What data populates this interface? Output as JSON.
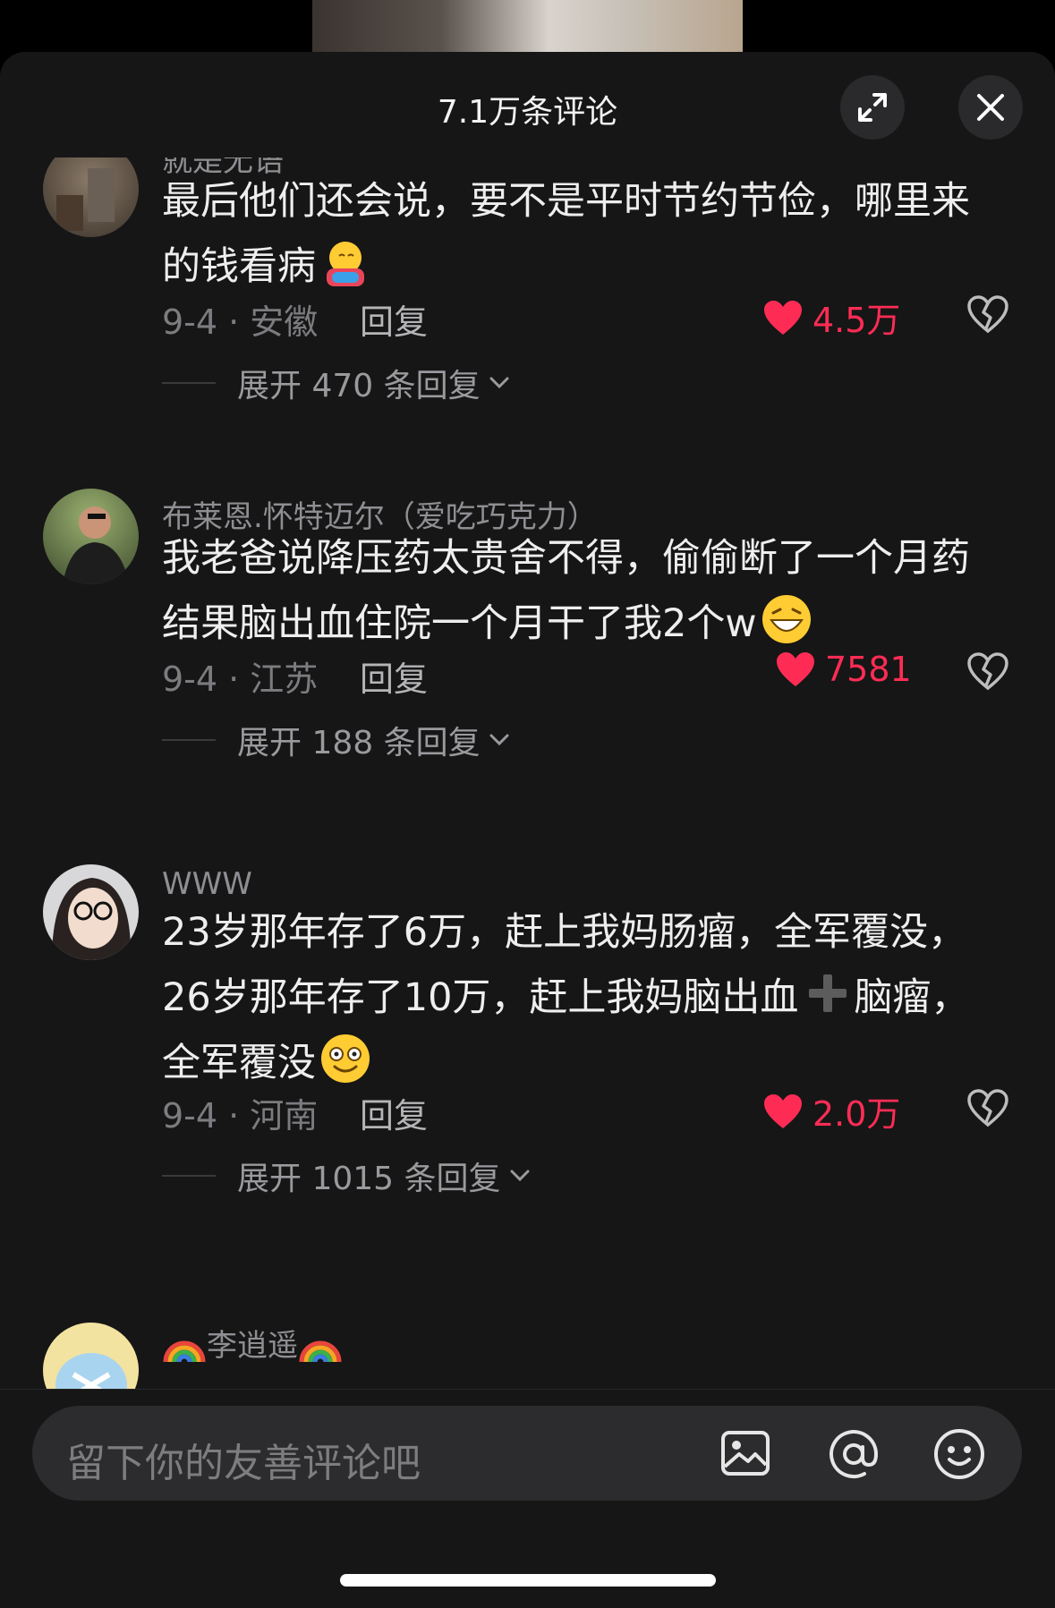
{
  "header": {
    "title": "7.1万条评论"
  },
  "comments": [
    {
      "username": "就是无语",
      "text": "最后他们还会说，要不是平时节约节俭，哪里来的钱看病",
      "date_location": "9-4 · 安徽",
      "reply_label": "回复",
      "likes": "4.5万",
      "expand_label": "展开 470 条回复",
      "emoji": "hugging-face-emoji"
    },
    {
      "username": "布莱恩.怀特迈尔（爱吃巧克力）",
      "text": "我老爸说降压药太贵舍不得，偷偷断了一个月药结果脑出血住院一个月干了我2个w",
      "date_location": "9-4 · 江苏",
      "reply_label": "回复",
      "likes": "7581",
      "expand_label": "展开 188 条回复",
      "emoji": "grinning-squint-emoji"
    },
    {
      "username": "WWW",
      "text_lines": [
        "23岁那年存了6万，赶上我妈肠瘤，全军覆没，",
        "26岁那年存了10万，赶上我妈脑出血",
        "脑瘤，",
        "全军覆没"
      ],
      "date_location": "9-4 · 河南",
      "reply_label": "回复",
      "likes": "2.0万",
      "expand_label": "展开 1015 条回复",
      "emoji": "dizzy-smile-emoji"
    },
    {
      "username": "李逍遥"
    }
  ],
  "input": {
    "placeholder": "留下你的友善评论吧"
  },
  "colors": {
    "like": "#fe2c55",
    "sheet_bg": "#161616",
    "input_bg": "#2c2c2e"
  }
}
